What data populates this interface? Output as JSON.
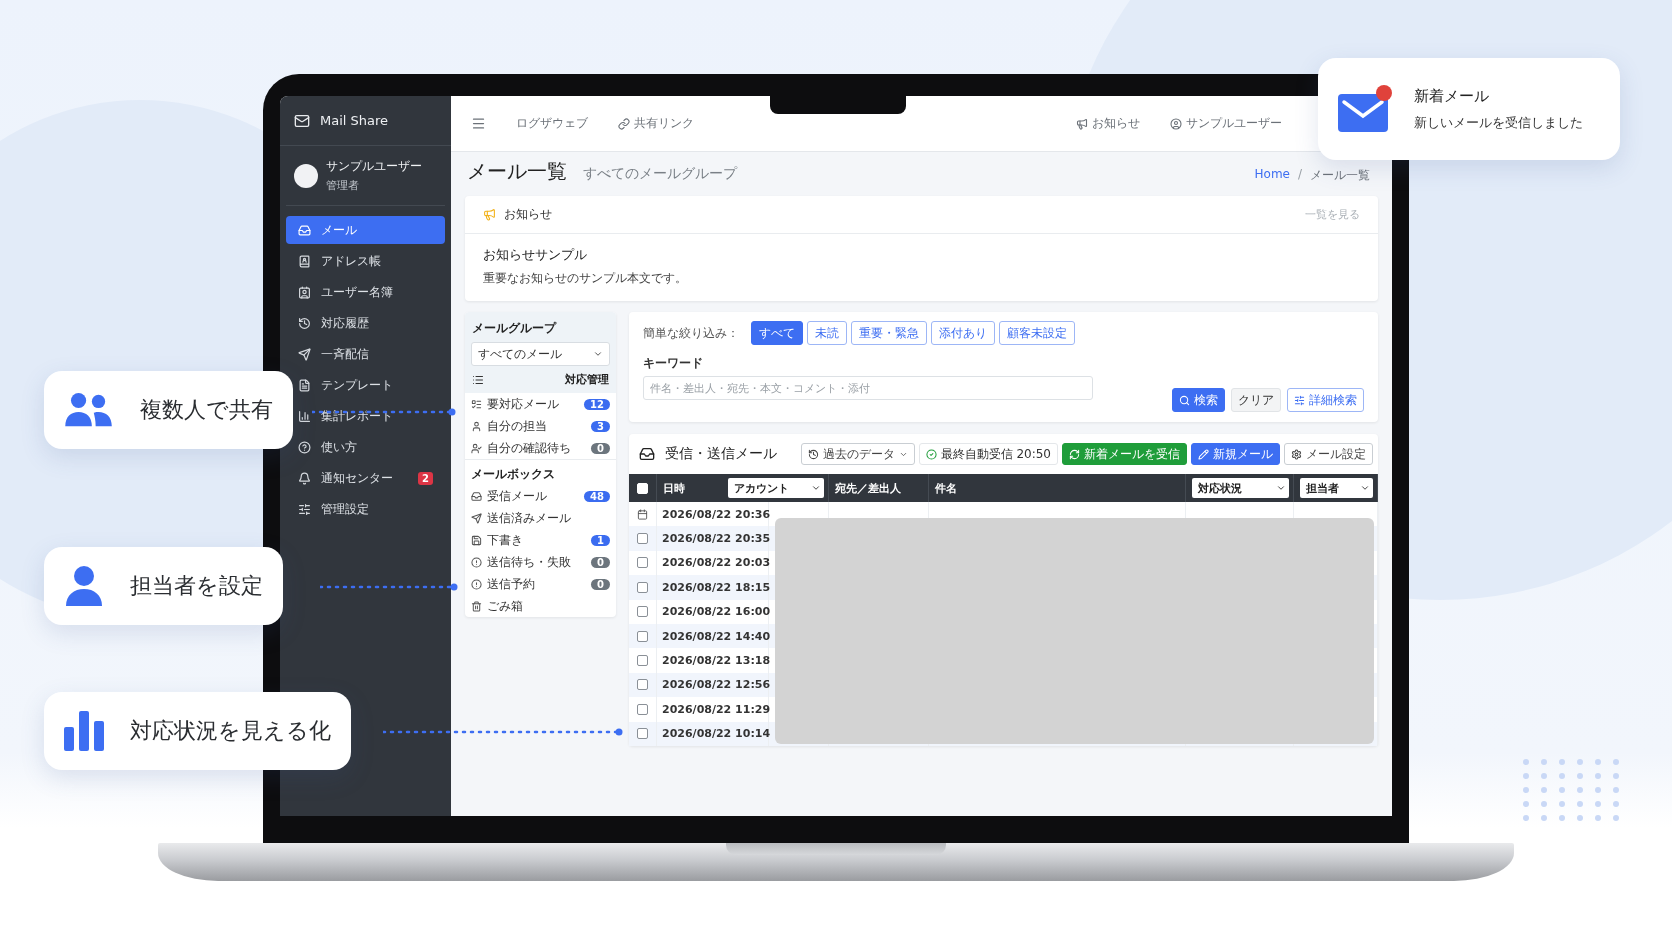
{
  "notification": {
    "title": "新着メール",
    "message": "新しいメールを受信しました",
    "unread": true
  },
  "callouts": [
    {
      "kind": "team",
      "label": "複数人で共有"
    },
    {
      "kind": "person",
      "label": "担当者を設定"
    },
    {
      "kind": "chart",
      "label": "対応状況を見える化"
    }
  ],
  "sidebar": {
    "brand": "Mail Share",
    "user": {
      "name": "サンプルユーザー",
      "role": "管理者"
    },
    "items": [
      {
        "label": "メール",
        "selected": true
      },
      {
        "label": "アドレス帳",
        "selected": false
      },
      {
        "label": "ユーザー名簿",
        "selected": false
      },
      {
        "label": "対応履歴",
        "selected": false
      },
      {
        "label": "一斉配信",
        "selected": false
      },
      {
        "label": "テンプレート",
        "selected": false
      },
      {
        "label": "集計レポート",
        "selected": false
      },
      {
        "label": "使い方",
        "selected": false
      },
      {
        "label": "通知センター",
        "selected": false,
        "badge": "2"
      },
      {
        "label": "管理設定",
        "selected": false
      }
    ]
  },
  "topbar": {
    "links": [
      {
        "label": "ログザウェブ"
      },
      {
        "label": "共有リンク"
      }
    ],
    "right": [
      {
        "label": "お知らせ"
      },
      {
        "label": "サンプルユーザー"
      }
    ]
  },
  "page": {
    "title": "メール一覧",
    "subtitle": "すべてのメールグループ",
    "separator": "/",
    "breadcrumb": [
      {
        "label": "Home",
        "link": true
      },
      {
        "label": "メール一覧",
        "link": false
      }
    ]
  },
  "notice": {
    "heading": "お知らせ",
    "more": "一覧を見る",
    "title": "お知らせサンプル",
    "body": "重要なお知らせのサンプル本文です。"
  },
  "group_panel": {
    "label": "メールグループ",
    "select": "すべてのメール",
    "section": "対応管理",
    "items": [
      {
        "label": "要対応メール",
        "badge": "12",
        "color": "#3b6cf0"
      },
      {
        "label": "自分の担当",
        "badge": "3",
        "color": "#3b6cf0"
      },
      {
        "label": "自分の確認待ち",
        "badge": "0",
        "color": "#6c757d"
      }
    ],
    "mailbox_label": "メールボックス",
    "mailboxes": [
      {
        "label": "受信メール",
        "badge": "48",
        "color": "#3b6cf0"
      },
      {
        "label": "送信済みメール"
      },
      {
        "label": "下書き",
        "badge": "1",
        "color": "#3b6cf0"
      },
      {
        "label": "送信待ち・失敗",
        "badge": "0",
        "color": "#6c757d"
      },
      {
        "label": "送信予約",
        "badge": "0",
        "color": "#6c757d"
      },
      {
        "label": "ごみ箱"
      }
    ]
  },
  "filter": {
    "label": "簡単な絞り込み：",
    "chips": [
      {
        "label": "すべて",
        "selected": true
      },
      {
        "label": "未読",
        "selected": false
      },
      {
        "label": "重要・緊急",
        "selected": false
      },
      {
        "label": "添付あり",
        "selected": false
      },
      {
        "label": "顧客未設定",
        "selected": false
      }
    ],
    "keyword_label": "キーワード",
    "placeholder": "件名・差出人・宛先・本文・コメント・添付",
    "buttons": [
      {
        "kind": "primary",
        "label": "検索"
      },
      {
        "kind": "light",
        "label": "クリア"
      },
      {
        "kind": "outline",
        "label": "詳細検索"
      }
    ]
  },
  "mail_table": {
    "title": "受信・送信メール",
    "actions": [
      {
        "kind": "dropdown",
        "label": "過去のデータ"
      },
      {
        "kind": "status",
        "label": "最終自動受信 20:50"
      },
      {
        "kind": "success",
        "label": "新着メールを受信"
      },
      {
        "kind": "primary",
        "label": "新規メール"
      },
      {
        "kind": "plain",
        "label": "メール設定"
      }
    ],
    "select_all": {
      "checked": false
    },
    "columns": {
      "date": "日時",
      "account": "アカウント",
      "party": "宛先／差出人",
      "subject": "件名",
      "status": "対応状況",
      "assignee": "担当者"
    },
    "rows": [
      {
        "kind": "scheduled",
        "datetime": "2026/08/22 20:36"
      },
      {
        "kind": "mail",
        "checked": false,
        "datetime": "2026/08/22 20:35"
      },
      {
        "kind": "mail",
        "checked": false,
        "datetime": "2026/08/22 20:03"
      },
      {
        "kind": "mail",
        "checked": false,
        "datetime": "2026/08/22 18:15"
      },
      {
        "kind": "mail",
        "checked": false,
        "datetime": "2026/08/22 16:00"
      },
      {
        "kind": "mail",
        "checked": false,
        "datetime": "2026/08/22 14:40"
      },
      {
        "kind": "mail",
        "checked": false,
        "datetime": "2026/08/22 13:18"
      },
      {
        "kind": "mail",
        "checked": false,
        "datetime": "2026/08/22 12:56"
      },
      {
        "kind": "mail",
        "checked": false,
        "datetime": "2026/08/22 11:29"
      },
      {
        "kind": "mail",
        "checked": false,
        "datetime": "2026/08/22 10:14"
      }
    ]
  }
}
